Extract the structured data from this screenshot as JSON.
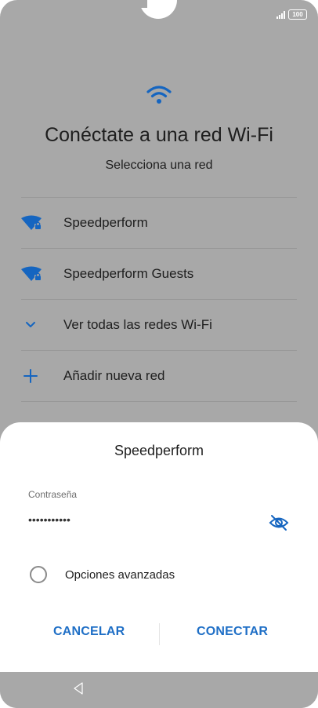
{
  "status_bar": {
    "battery": "100"
  },
  "header": {
    "icon": "wifi-icon",
    "title": "Conéctate a una red Wi-Fi",
    "subtitle": "Selecciona una red"
  },
  "network_list": [
    {
      "label": "Speedperform",
      "icon": "wifi-lock-icon"
    },
    {
      "label": "Speedperform Guests",
      "icon": "wifi-lock-icon"
    },
    {
      "label": "Ver todas las redes Wi-Fi",
      "icon": "chevron-down-icon"
    },
    {
      "label": "Añadir nueva red",
      "icon": "plus-icon"
    }
  ],
  "dialog": {
    "title": "Speedperform",
    "password_label": "Contraseña",
    "password_value": "•••••••••••",
    "advanced_options_label": "Opciones avanzadas",
    "cancel_label": "CANCELAR",
    "connect_label": "CONECTAR"
  },
  "colors": {
    "accent": "#1f6fc6",
    "wifi_blue": "#1565c0",
    "scrim": "#a8a8a8"
  }
}
